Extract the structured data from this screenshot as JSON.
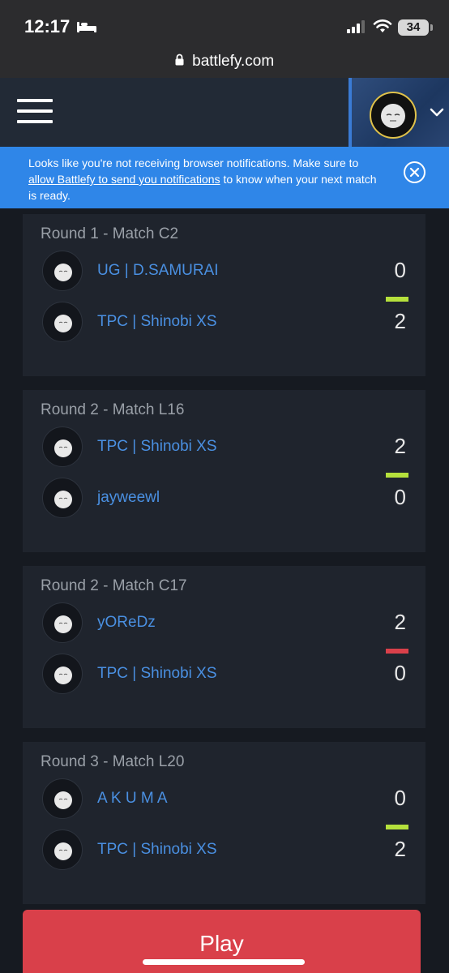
{
  "status_bar": {
    "time": "12:17",
    "battery": "34"
  },
  "browser": {
    "url": "battlefy.com"
  },
  "banner": {
    "text_before": "Looks like you're not receiving browser notifications. Make sure to ",
    "link_text": "allow Battlefy to send you notifications",
    "text_after": " to know when your next match is ready."
  },
  "matches": [
    {
      "title": "Round 1 - Match C2",
      "players": [
        {
          "name": "UG | D.SAMURAI",
          "score": "0"
        },
        {
          "name": "TPC | Shinobi XS",
          "score": "2"
        }
      ],
      "bar_color": "#b5e03c"
    },
    {
      "title": "Round 2 - Match L16",
      "players": [
        {
          "name": "TPC | Shinobi XS",
          "score": "2"
        },
        {
          "name": "jayweewl",
          "score": "0"
        }
      ],
      "bar_color": "#b5e03c"
    },
    {
      "title": "Round 2 - Match C17",
      "players": [
        {
          "name": "yOReDz",
          "score": "2"
        },
        {
          "name": "TPC | Shinobi XS",
          "score": "0"
        }
      ],
      "bar_color": "#d9404a"
    },
    {
      "title": "Round 3 - Match L20",
      "players": [
        {
          "name": "A K U M A",
          "score": "0"
        },
        {
          "name": "TPC | Shinobi XS",
          "score": "2"
        }
      ],
      "bar_color": "#b5e03c"
    }
  ],
  "play_button": {
    "label": "Play"
  },
  "colors": {
    "accent_blue": "#2f86e8",
    "win_green": "#b5e03c",
    "loss_red": "#d9404a",
    "play_red": "#d9404a"
  }
}
